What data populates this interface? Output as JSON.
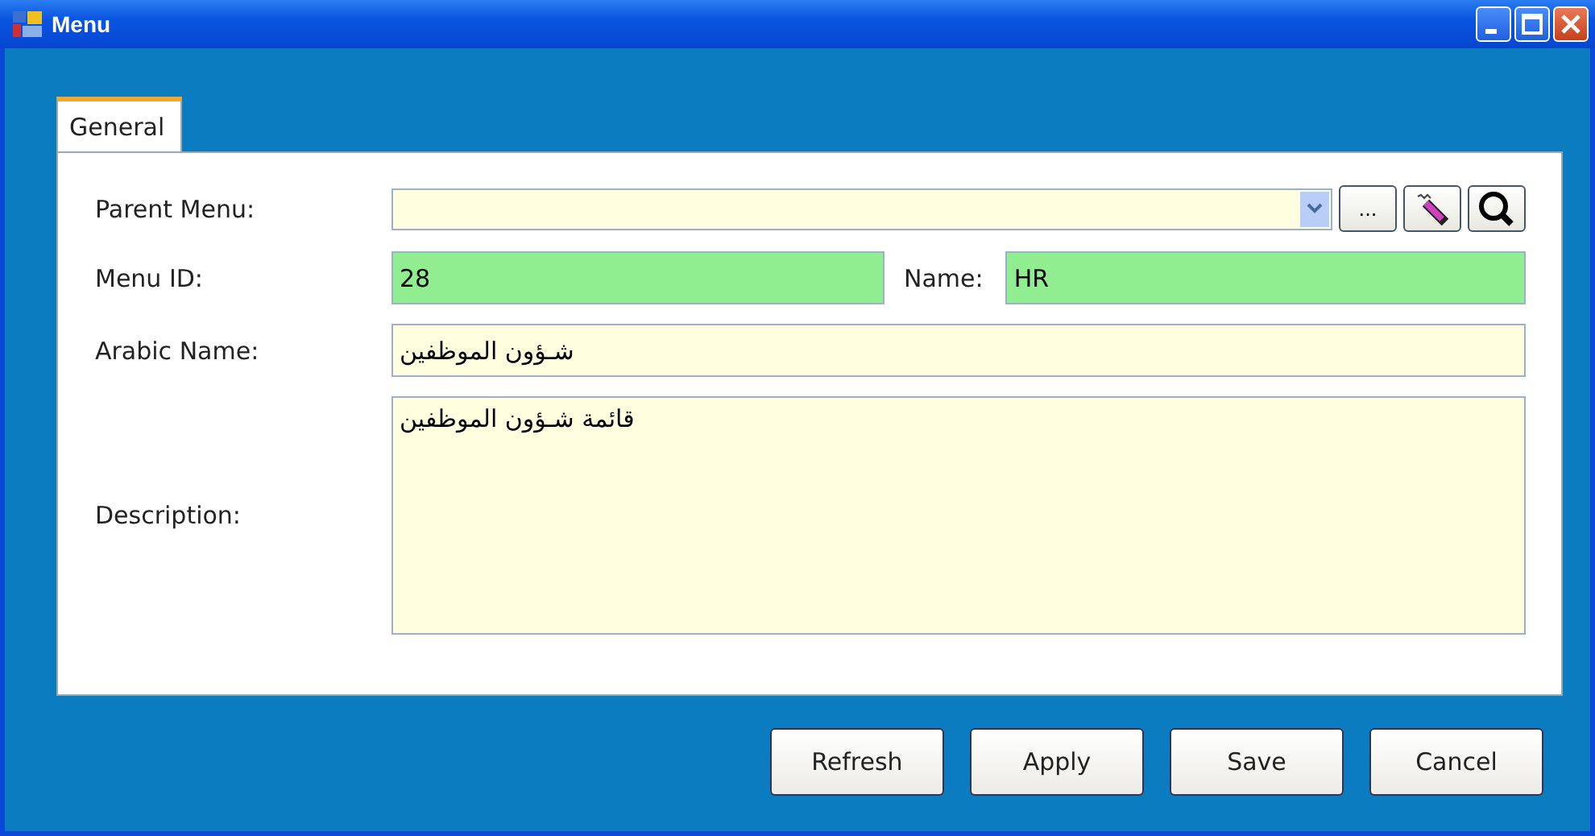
{
  "window": {
    "title": "Menu"
  },
  "tabs": [
    {
      "label": "General",
      "selected": true
    }
  ],
  "form": {
    "parent_menu": {
      "label": "Parent Menu:"
    },
    "menu_id": {
      "label": "Menu ID:",
      "value": "28"
    },
    "name": {
      "label": "Name:",
      "value": "HR"
    },
    "arabic_name": {
      "label": "Arabic Name:",
      "value": "شـؤون الموظفين"
    },
    "description": {
      "label": "Description:",
      "value": "قائمة شـؤون الموظفين"
    },
    "browse_button": "..."
  },
  "buttons": [
    {
      "label": "Refresh"
    },
    {
      "label": "Apply"
    },
    {
      "label": "Save"
    },
    {
      "label": "Cancel"
    }
  ]
}
